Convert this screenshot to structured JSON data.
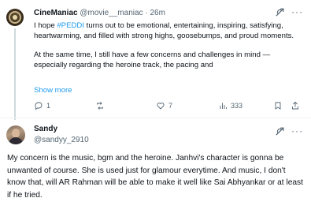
{
  "tweet": {
    "author_name": "CineManiac",
    "author_handle": "@movie__maniac",
    "separator": "·",
    "timestamp": "26m",
    "text_part1_prefix": "I hope ",
    "text_part1_hashtag": "#PEDDI",
    "text_part1_suffix": " turns out to be emotional, entertaining, inspiring, satisfying, heartwarming, and filled with strong highs, goosebumps, and proud moments.",
    "text_part2": "At the same time, I still have a few concerns and challenges in mind — especially regarding the heroine track, the pacing and",
    "show_more_label": "Show more",
    "replies": "1",
    "reposts": "",
    "likes": "7",
    "views": "333",
    "icons": {
      "reply": "reply-icon",
      "repost": "repost-icon",
      "like": "heart-icon",
      "views": "views-icon",
      "bookmark": "bookmark-icon",
      "share": "share-icon",
      "grok": "grok-icon",
      "more": "more-icon"
    }
  },
  "reply": {
    "author_name": "Sandy",
    "author_handle": "@sandyy_2910",
    "text": "My concern is the music, bgm and the heroine. Janhvi's character is gonna be unwanted of course. She is used just for glamour everytime. And music, I don't know that, will AR Rahman will be able to make it well like Sai Abhyankar or at least if he tried."
  },
  "colors": {
    "link": "#1d9bf0",
    "text": "#0f1419",
    "muted": "#536471",
    "divider": "#eff3f4"
  }
}
